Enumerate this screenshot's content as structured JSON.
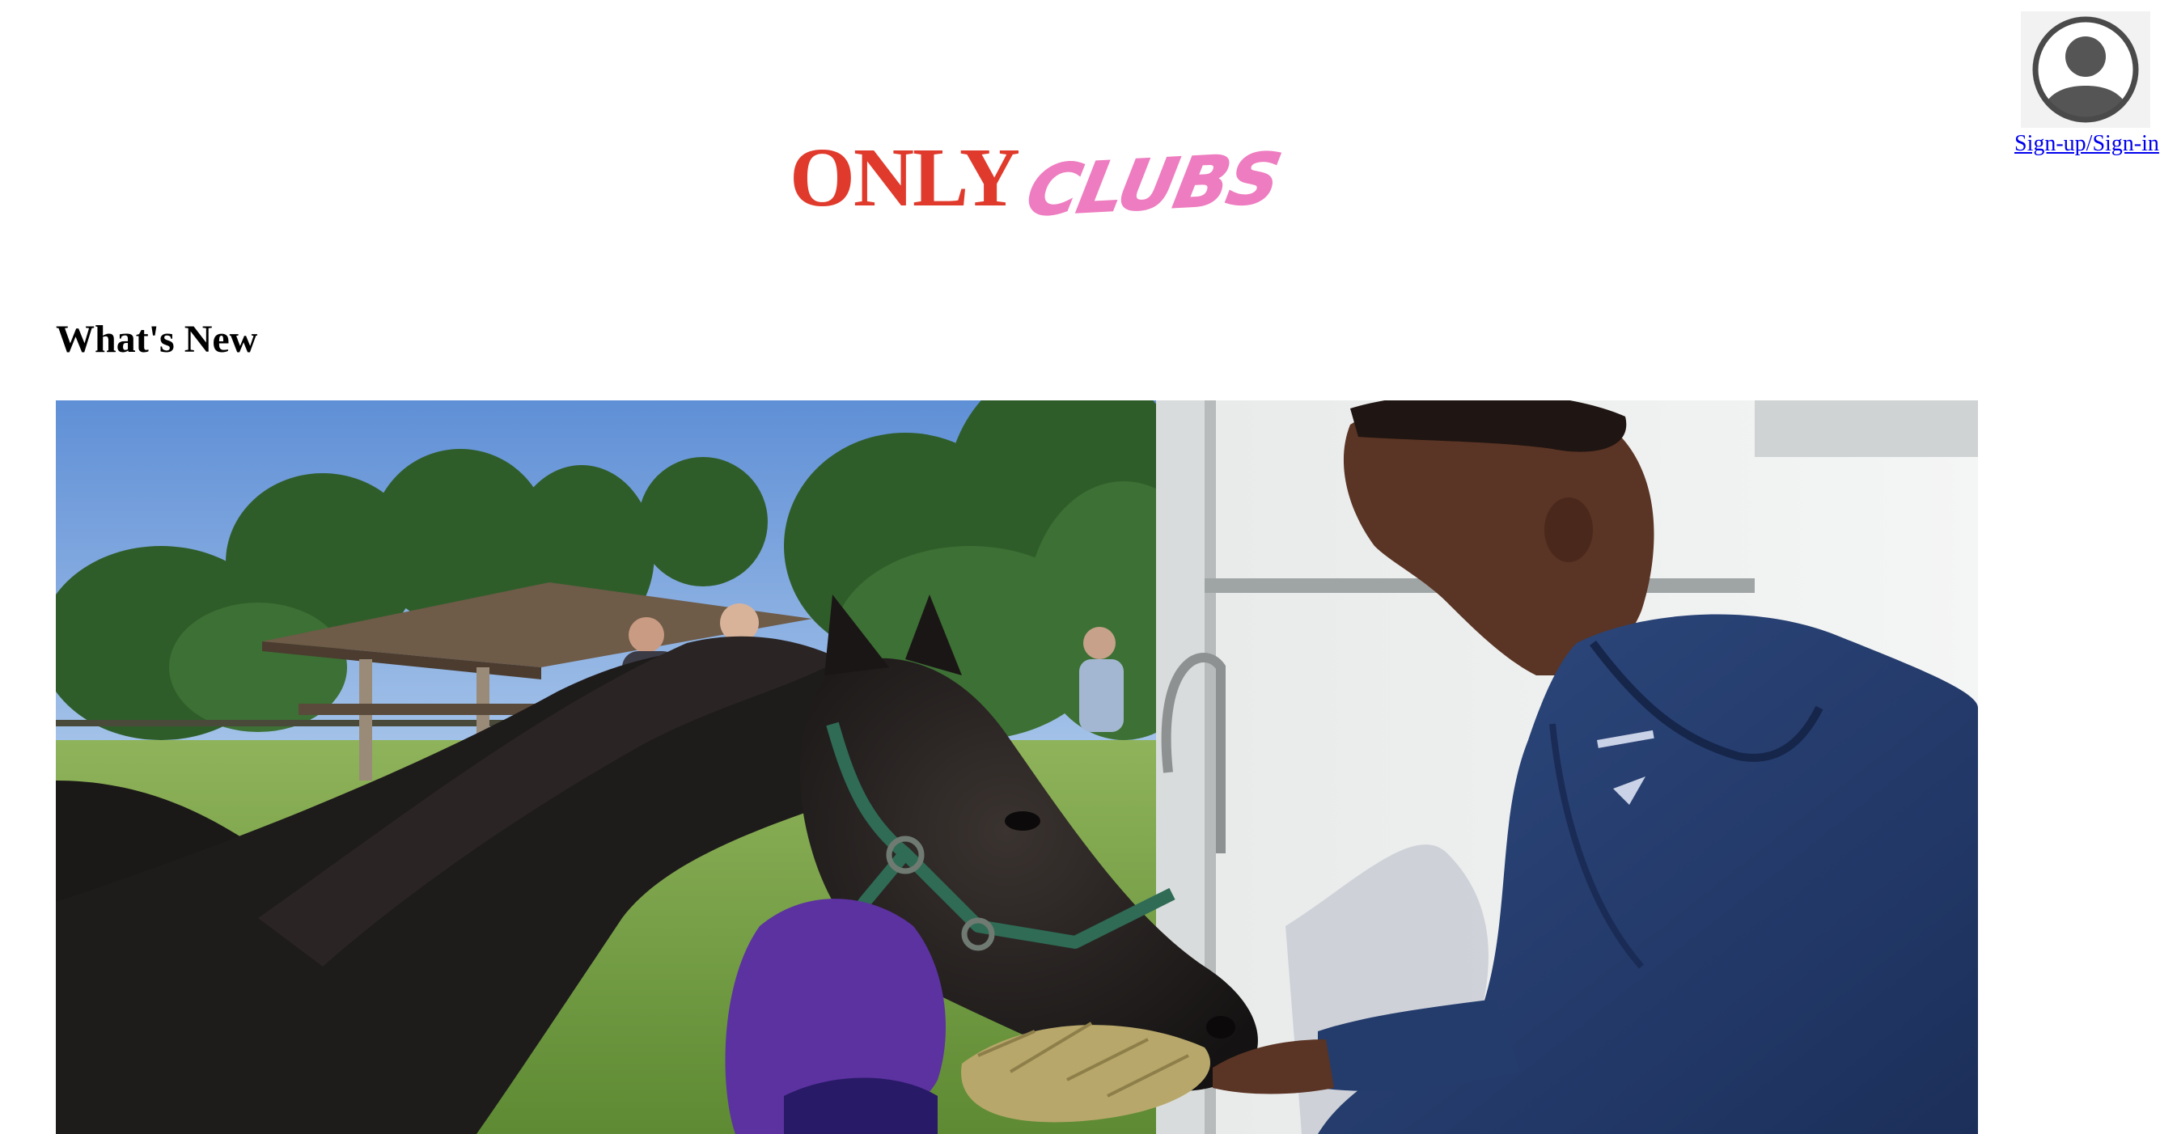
{
  "header": {
    "logo": {
      "part1": "ONLY",
      "part2": "CLUBS",
      "part1_color": "#e03a2c",
      "part2_color": "#ee7cc0"
    },
    "account": {
      "avatar_icon": "user-avatar-icon",
      "signin_label": "Sign-up/Sign-in",
      "link_color": "#0000ee"
    }
  },
  "main": {
    "section_title": "What's New",
    "featured_image": {
      "icon": "featured-news-photo"
    }
  }
}
